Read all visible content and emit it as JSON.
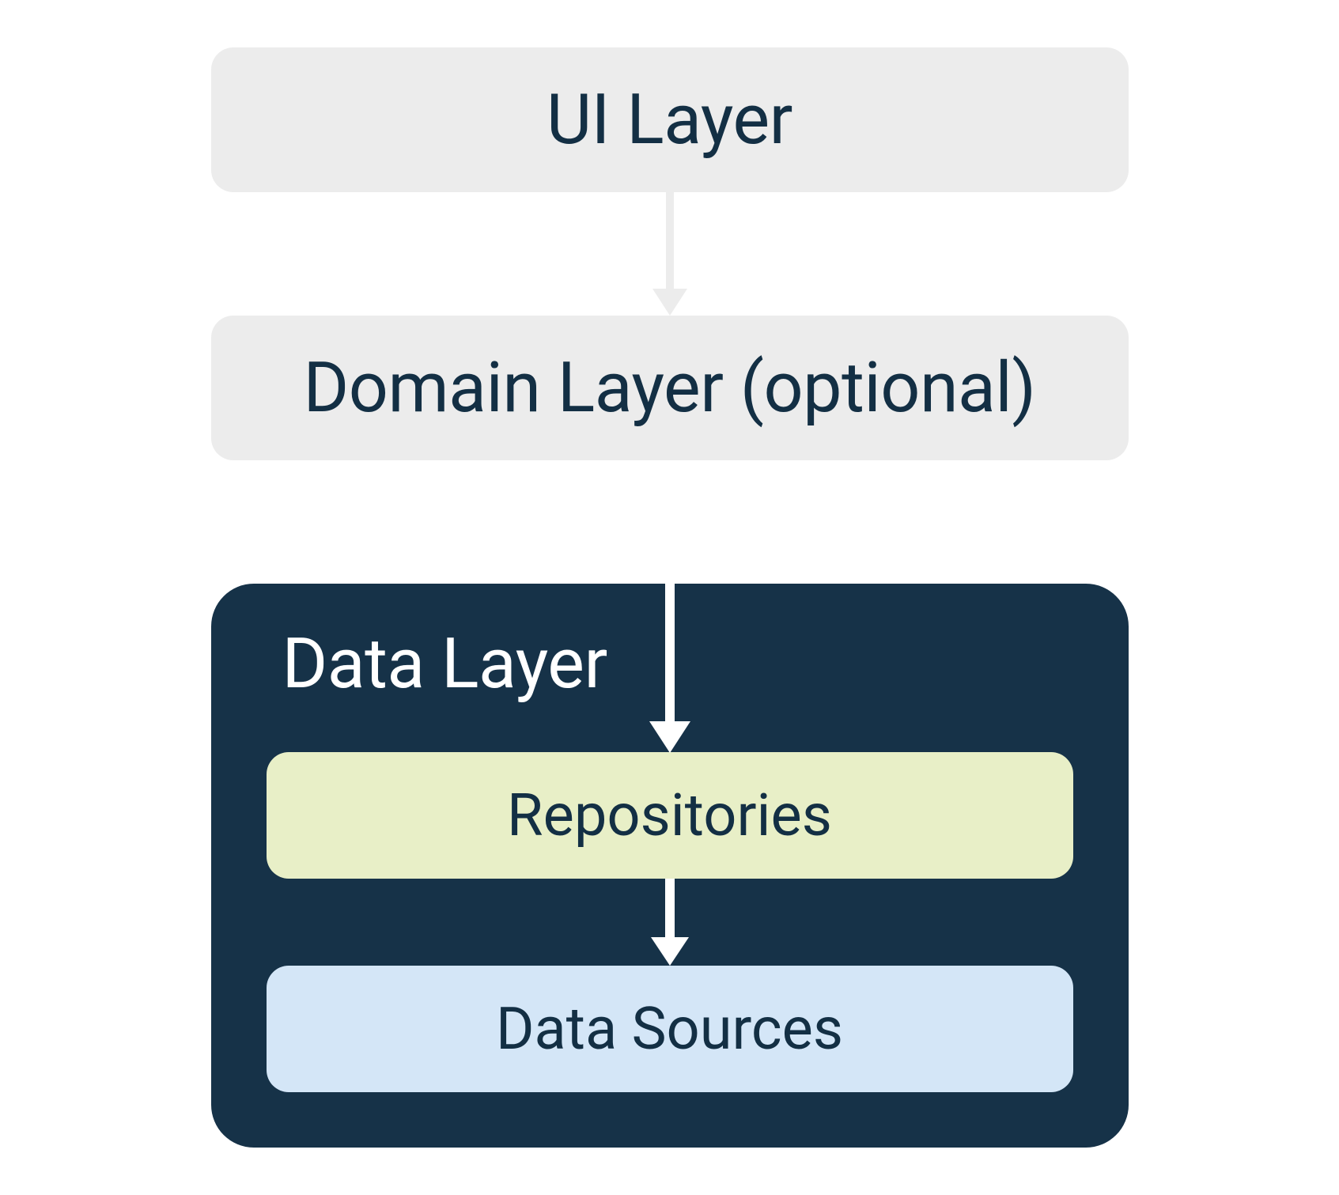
{
  "diagram": {
    "ui_layer": "UI Layer",
    "domain_layer": "Domain Layer (optional)",
    "data_layer": {
      "title": "Data Layer",
      "repositories": "Repositories",
      "data_sources": "Data Sources"
    }
  },
  "colors": {
    "light_box_bg": "#ececec",
    "dark_container_bg": "#163248",
    "repositories_bg": "#e8efc7",
    "data_sources_bg": "#d4e6f7",
    "text_dark": "#132f44",
    "text_light": "#ffffff"
  }
}
